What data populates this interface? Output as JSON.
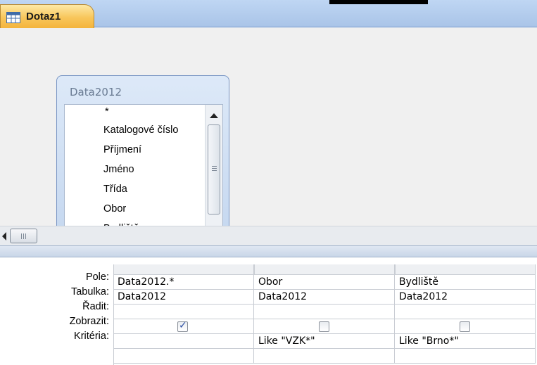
{
  "tab": {
    "title": "Dotaz1"
  },
  "table_box": {
    "title": "Data2012",
    "fields": [
      "*",
      "Katalogové číslo",
      "Příjmení",
      "Jméno",
      "Třída",
      "Obor",
      "Bydliště"
    ]
  },
  "grid": {
    "row_labels": {
      "field": "Pole:",
      "table": "Tabulka:",
      "sort": "Řadit:",
      "show": "Zobrazit:",
      "criteria": "Kritéria:"
    },
    "columns": [
      {
        "field": "Data2012.*",
        "table": "Data2012",
        "sort": "",
        "show": true,
        "criteria": ""
      },
      {
        "field": "Obor",
        "table": "Data2012",
        "sort": "",
        "show": false,
        "criteria": "Like \"VZK*\""
      },
      {
        "field": "Bydliště",
        "table": "Data2012",
        "sort": "",
        "show": false,
        "criteria": "Like \"Brno*\""
      }
    ]
  },
  "colors": {
    "tab_active": "#f8c65b",
    "pane_bg": "#f0f0f0",
    "table_header": "#c3d6ef"
  },
  "icons": [
    "query-design-icon",
    "scroll-up-icon",
    "scroll-down-icon",
    "scroll-left-icon",
    "checkbox-checked-icon"
  ]
}
